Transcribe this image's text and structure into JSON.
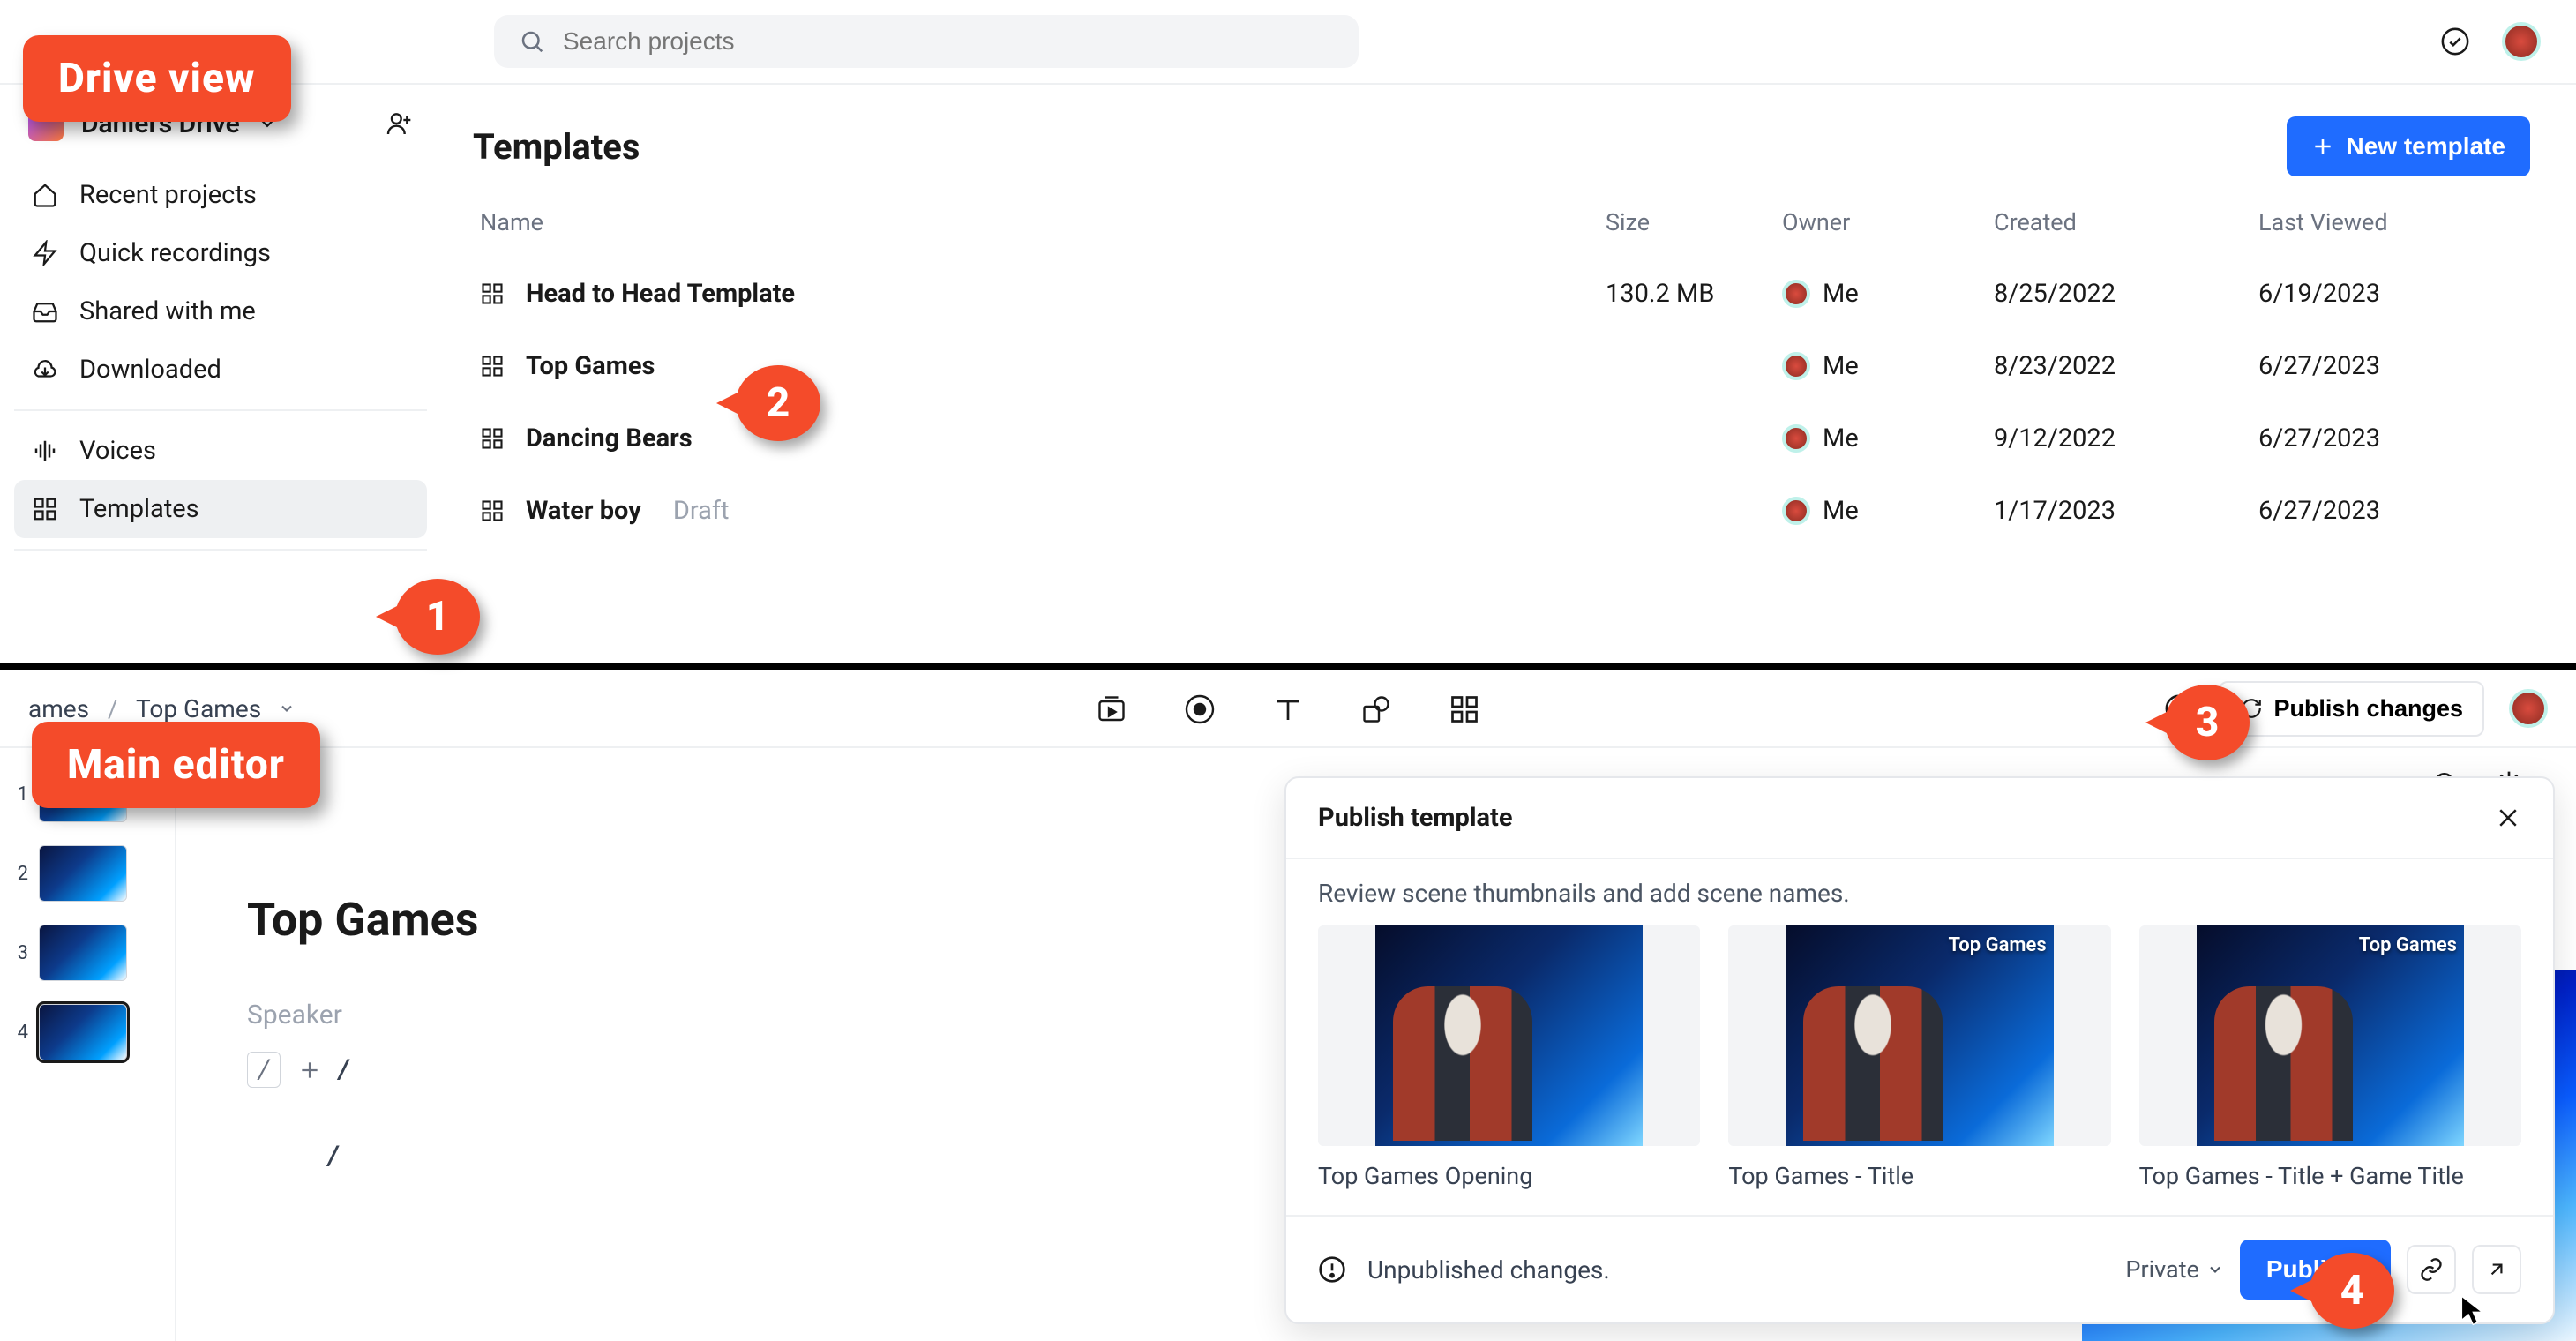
{
  "annotations": {
    "badge_drive": "Drive view",
    "badge_editor": "Main editor",
    "m1": "1",
    "m2": "2",
    "m3": "3",
    "m4": "4"
  },
  "drive": {
    "search_placeholder": "Search projects",
    "drive_name": "Daniel's Drive",
    "nav": {
      "recent": "Recent projects",
      "quick": "Quick recordings",
      "shared": "Shared with me",
      "downloaded": "Downloaded",
      "voices": "Voices",
      "templates": "Templates"
    },
    "heading": "Templates",
    "new_template": "New template",
    "cols": {
      "name": "Name",
      "size": "Size",
      "owner": "Owner",
      "created": "Created",
      "viewed": "Last Viewed"
    },
    "rows": [
      {
        "name": "Head to Head Template",
        "draft": "",
        "size": "130.2 MB",
        "owner": "Me",
        "created": "8/25/2022",
        "viewed": "6/19/2023"
      },
      {
        "name": "Top Games",
        "draft": "",
        "size": "",
        "owner": "Me",
        "created": "8/23/2022",
        "viewed": "6/27/2023"
      },
      {
        "name": "Dancing Bears",
        "draft": "",
        "size": "",
        "owner": "Me",
        "created": "9/12/2022",
        "viewed": "6/27/2023"
      },
      {
        "name": "Water boy",
        "draft": "Draft",
        "size": "",
        "owner": "Me",
        "created": "1/17/2023",
        "viewed": "6/27/2023"
      }
    ]
  },
  "editor": {
    "breadcrumb": {
      "parent_partial": "ames",
      "current": "Top Games"
    },
    "publish_changes": "Publish changes",
    "doc_title": "Top Games",
    "speaker": "Speaker",
    "slash1": "/",
    "slash2": "/",
    "scenes": [
      "1",
      "2",
      "3",
      "4"
    ],
    "active_scene_index": 3
  },
  "panel": {
    "title": "Publish template",
    "subtitle": "Review scene thumbnails and add scene names.",
    "cards": [
      {
        "overlay": "",
        "caption": "Top Games Opening"
      },
      {
        "overlay": "Top Games",
        "caption": "Top Games - Title"
      },
      {
        "overlay": "Top Games",
        "caption": "Top Games - Title + Game Title"
      }
    ],
    "footer_msg": "Unpublished changes.",
    "visibility": "Private",
    "publish": "Publish"
  }
}
